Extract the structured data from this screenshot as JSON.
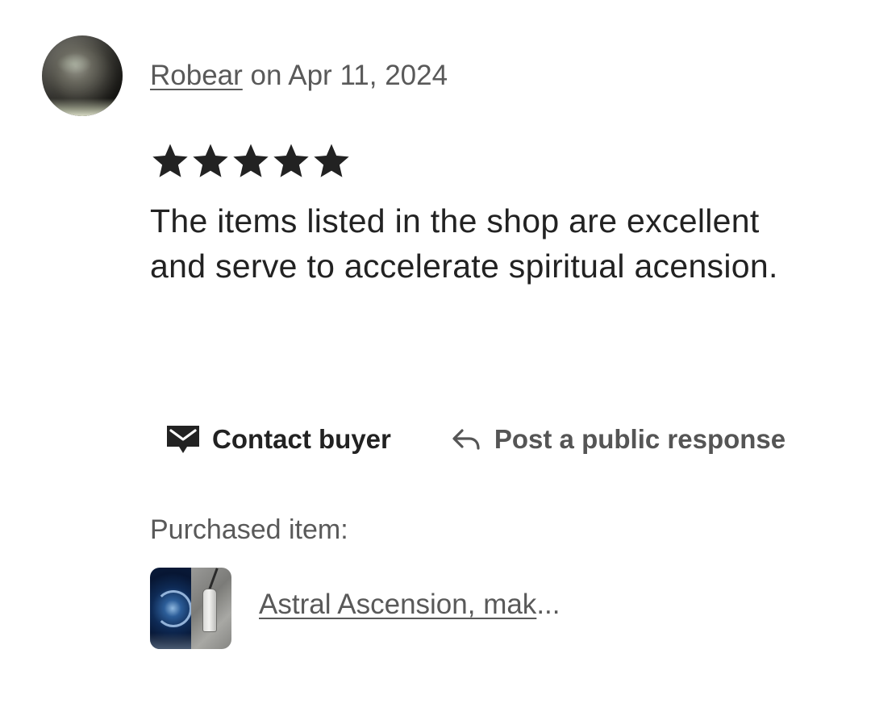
{
  "review": {
    "author": "Robear",
    "date_prefix": " on ",
    "date": "Apr 11, 2024",
    "rating": 5,
    "rating_max": 5,
    "text": "The items listed in the shop are excellent and serve to accelerate spiritual acension."
  },
  "actions": {
    "contact_label": "Contact buyer",
    "contact_icon": "envelope-icon",
    "respond_label": "Post a public response",
    "respond_icon": "reply-arrow-icon"
  },
  "purchased": {
    "label": "Purchased item:",
    "item_title": "Astral Ascension, mak",
    "ellipsis": "..."
  },
  "colors": {
    "text_primary": "#222222",
    "text_secondary": "#595959",
    "star": "#222222"
  }
}
